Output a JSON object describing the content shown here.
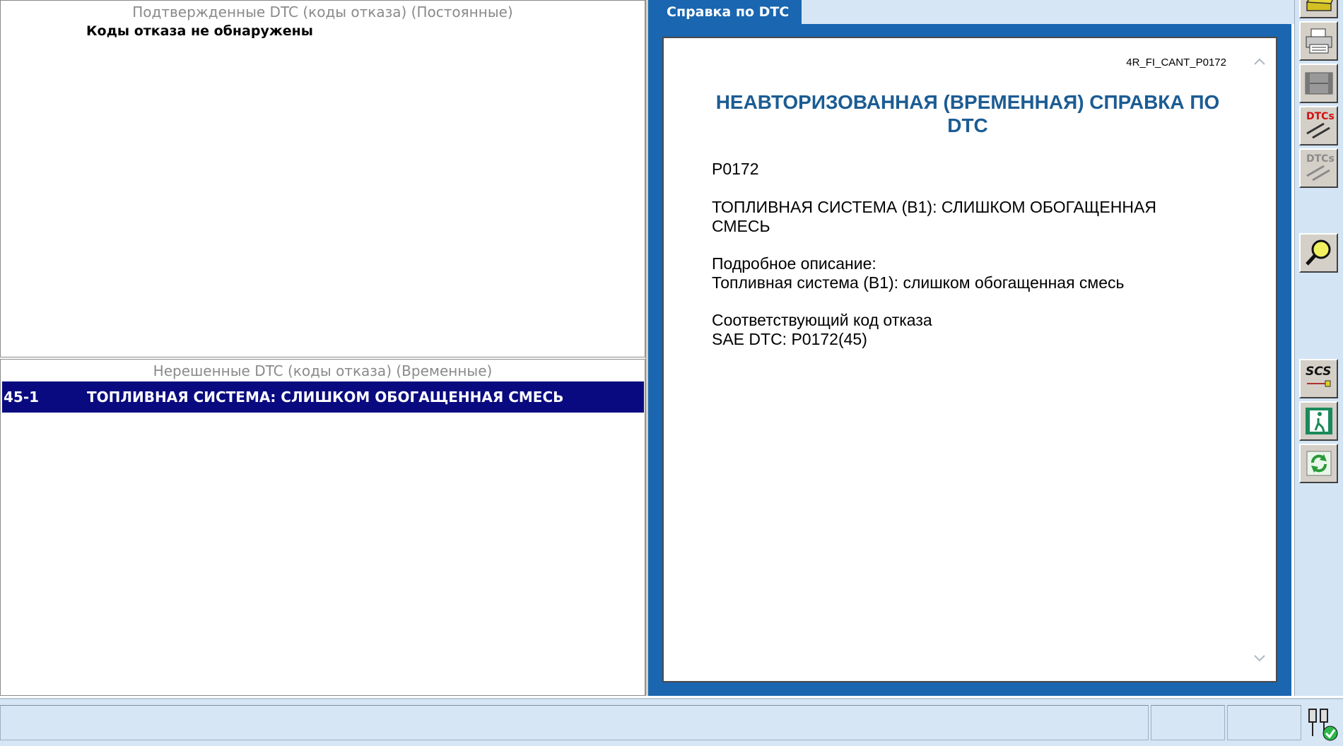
{
  "confirmed_panel": {
    "title": "Подтвержденные DTC (коды отказа) (Постоянные)",
    "empty_message": "Коды отказа не обнаружены"
  },
  "pending_panel": {
    "title": "Нерешенные DTC (коды отказа) (Временные)",
    "rows": [
      {
        "code": "45-1",
        "description": "ТОПЛИВНАЯ СИСТЕМА: СЛИШКОМ ОБОГАЩЕННАЯ СМЕСЬ",
        "selected": true
      }
    ]
  },
  "help": {
    "tab_label": "Справка по DTC",
    "doc_id": "4R_FI_CANT_P0172",
    "title": "НЕАВТОРИЗОВАННАЯ (ВРЕМЕННАЯ) СПРАВКА ПО DTC",
    "code": "P0172",
    "system_name_line1": "ТОПЛИВНАЯ СИСТЕМА (B1): СЛИШКОМ ОБОГАЩЕННАЯ",
    "system_name_line2": "СМЕСЬ",
    "detail_label": "Подробное описание:",
    "detail_text": "Топливная система (B1): слишком обогащенная смесь",
    "related_label": "Соответствующий код отказа",
    "related_value": "SAE DTC: P0172(45)"
  },
  "toolbar": {
    "icons": [
      "folder-icon",
      "print-icon",
      "film-icon",
      "dtc-clear-icon",
      "dtc-disabled-icon",
      "zoom-icon",
      "scs-icon",
      "exit-icon",
      "refresh-icon"
    ],
    "accent": "#1a66b0",
    "selection_color": "#0a0a80",
    "title_color": "#1c5c93"
  },
  "statusbar": {
    "connection_icon": "connection-ok-icon"
  }
}
